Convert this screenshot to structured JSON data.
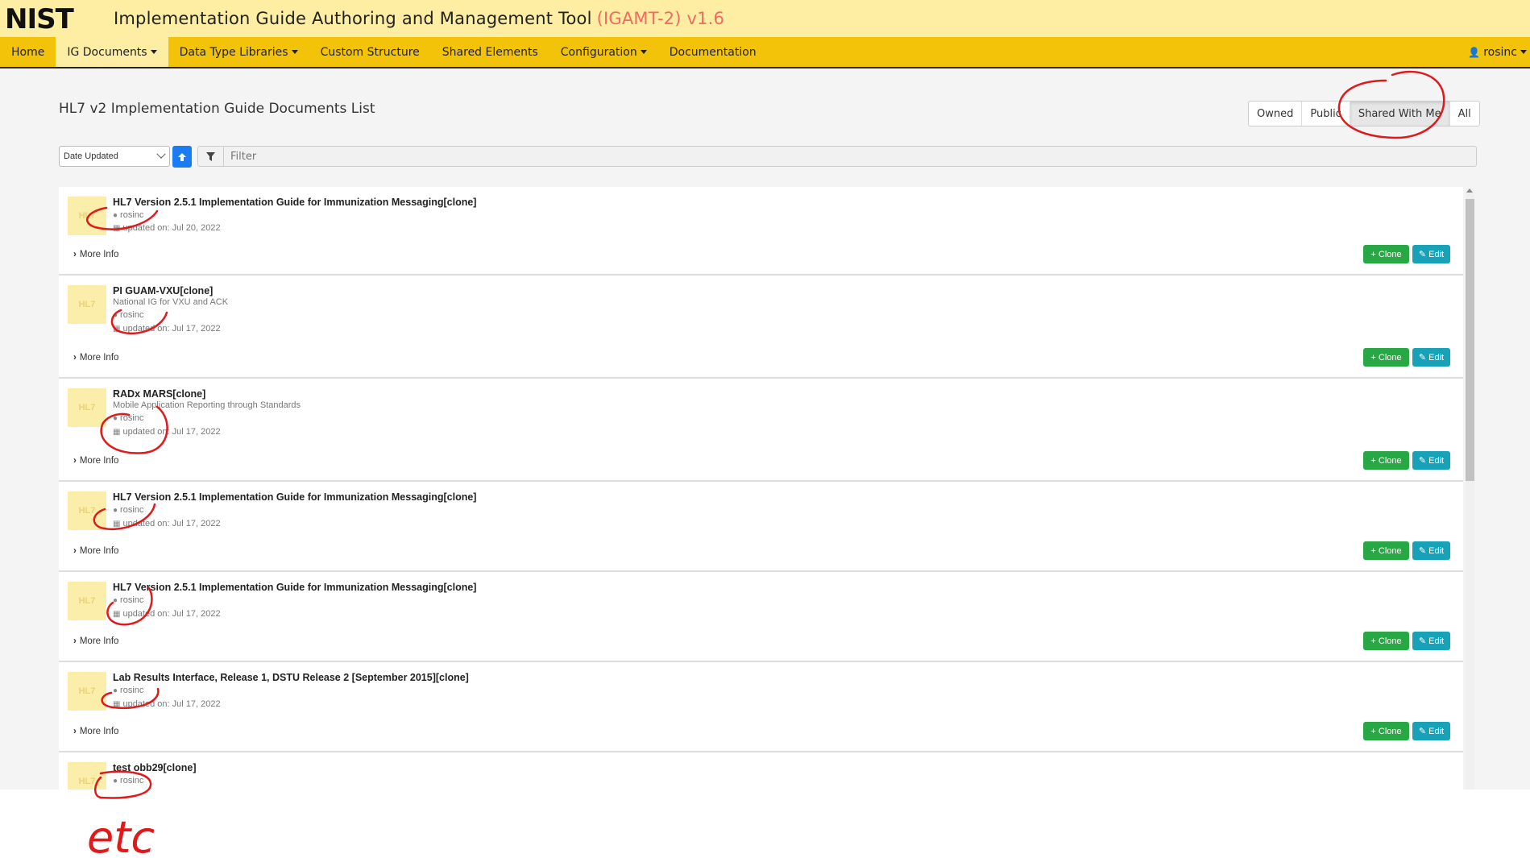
{
  "header": {
    "logo_text": "NIST",
    "title": "Implementation Guide Authoring and Management Tool",
    "version": "(IGAMT-2) v1.6"
  },
  "nav": {
    "items": [
      {
        "label": "Home"
      },
      {
        "label": "IG Documents"
      },
      {
        "label": "Data Type Libraries"
      },
      {
        "label": "Custom Structure"
      },
      {
        "label": "Shared Elements"
      },
      {
        "label": "Configuration"
      },
      {
        "label": "Documentation"
      }
    ],
    "user": "rosinc"
  },
  "page": {
    "title": "HL7 v2 Implementation Guide Documents List",
    "filters": [
      "Owned",
      "Public",
      "Shared With Me",
      "All"
    ],
    "active_filter": "Shared With Me",
    "sort_value": "Date Updated",
    "filter_placeholder": "Filter"
  },
  "documents": [
    {
      "title": "HL7 Version 2.5.1 Implementation Guide for Immunization Messaging[clone]",
      "subtitle": "",
      "owner": "rosinc",
      "updated": "updated on: Jul 20, 2022"
    },
    {
      "title": "PI GUAM-VXU[clone]",
      "subtitle": "National IG for VXU and ACK",
      "owner": "rosinc",
      "updated": "updated on: Jul 17, 2022"
    },
    {
      "title": "RADx MARS[clone]",
      "subtitle": "Mobile Application Reporting through Standards",
      "owner": "rosinc",
      "updated": "updated on: Jul 17, 2022"
    },
    {
      "title": "HL7 Version 2.5.1 Implementation Guide for Immunization Messaging[clone]",
      "subtitle": "",
      "owner": "rosinc",
      "updated": "updated on: Jul 17, 2022"
    },
    {
      "title": "HL7 Version 2.5.1 Implementation Guide for Immunization Messaging[clone]",
      "subtitle": "",
      "owner": "rosinc",
      "updated": "updated on: Jul 17, 2022"
    },
    {
      "title": "Lab Results Interface, Release 1, DSTU Release 2 [September 2015][clone]",
      "subtitle": "",
      "owner": "rosinc",
      "updated": "updated on: Jul 17, 2022"
    },
    {
      "title": "test obb29[clone]",
      "subtitle": "",
      "owner": "rosinc",
      "updated": ""
    }
  ],
  "card_labels": {
    "thumb": "HL7",
    "more_info": "More Info",
    "clone": "Clone",
    "edit": "Edit"
  },
  "annotation": {
    "note": "etc",
    "color": "#e0191b"
  },
  "colors": {
    "header_bg": "#fdeea3",
    "nav_bg": "#f3c309",
    "version_color": "#f26a63",
    "clone_btn": "#28a745",
    "edit_btn": "#17a2b8",
    "sort_btn": "#1a7cf5"
  }
}
